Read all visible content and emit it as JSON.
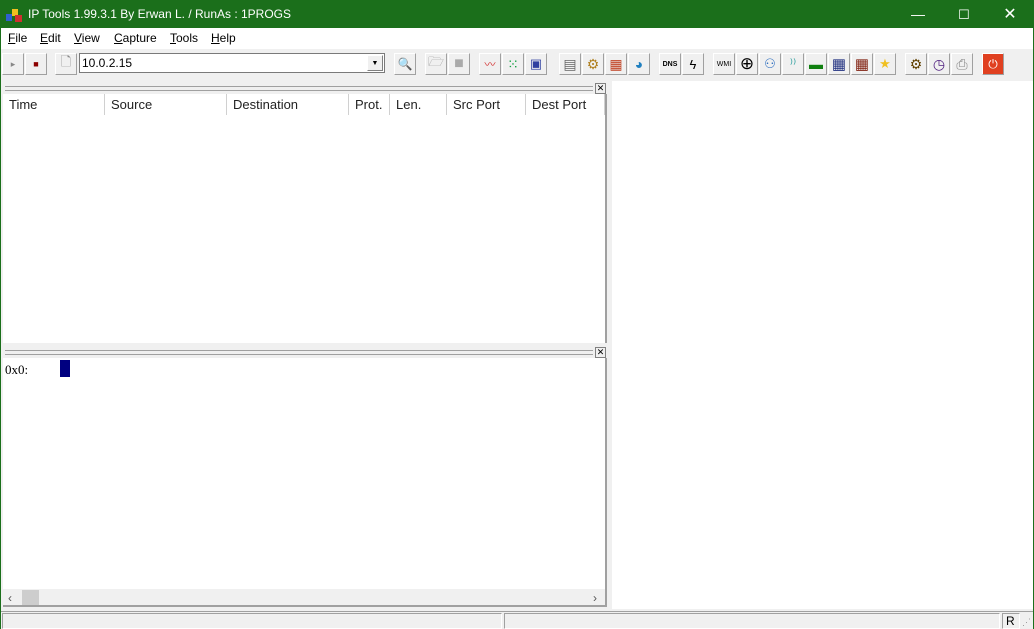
{
  "window": {
    "title": "IP Tools 1.99.3.1 By Erwan L. / RunAs : 1PROGS",
    "controls": {
      "minimize": "—",
      "maximize": "☐",
      "close": "✕"
    },
    "accent_color": "#1b6f1b"
  },
  "menubar": {
    "items": [
      {
        "label": "File",
        "accel": "F",
        "rest": "ile"
      },
      {
        "label": "Edit",
        "accel": "E",
        "rest": "dit"
      },
      {
        "label": "View",
        "accel": "V",
        "rest": "iew"
      },
      {
        "label": "Capture",
        "accel": "C",
        "rest": "apture"
      },
      {
        "label": "Tools",
        "accel": "T",
        "rest": "ools"
      },
      {
        "label": "Help",
        "accel": "H",
        "rest": "elp"
      }
    ]
  },
  "toolbar": {
    "ip_value": "10.0.2.15",
    "buttons": [
      {
        "name": "start-capture",
        "icon": "play-icon",
        "glyph": "▸"
      },
      {
        "name": "stop-capture",
        "icon": "stop-icon",
        "glyph": "■"
      },
      {
        "name": "new",
        "icon": "document-icon",
        "glyph": "🗋"
      },
      {
        "name": "search",
        "icon": "magnifier-icon",
        "glyph": "🔍"
      },
      {
        "name": "open",
        "icon": "folder-icon",
        "glyph": "🗁"
      },
      {
        "name": "blank",
        "icon": "gray-square-icon",
        "glyph": "■"
      },
      {
        "name": "graph",
        "icon": "line-graph-icon",
        "glyph": "〰"
      },
      {
        "name": "network-map",
        "icon": "network-nodes-icon",
        "glyph": "⁙"
      },
      {
        "name": "remote",
        "icon": "computers-icon",
        "glyph": "▣"
      },
      {
        "name": "servers",
        "icon": "servers-icon",
        "glyph": "▤"
      },
      {
        "name": "services",
        "icon": "gears-icon",
        "glyph": "⚙"
      },
      {
        "name": "firewall",
        "icon": "firewall-icon",
        "glyph": "▦"
      },
      {
        "name": "internet",
        "icon": "globe-icon",
        "glyph": "◕"
      },
      {
        "name": "dns",
        "icon": "dns-icon",
        "glyph": "DNS"
      },
      {
        "name": "trace",
        "icon": "trace-icon",
        "glyph": "ϟ"
      },
      {
        "name": "wmi",
        "icon": "wmi-icon",
        "glyph": "WMI"
      },
      {
        "name": "scanner",
        "icon": "crosshair-icon",
        "glyph": "⊕"
      },
      {
        "name": "users",
        "icon": "user-network-icon",
        "glyph": "⚇"
      },
      {
        "name": "ping",
        "icon": "signal-icon",
        "glyph": "⁾⁾"
      },
      {
        "name": "nic",
        "icon": "network-card-icon",
        "glyph": "▬"
      },
      {
        "name": "table-blue",
        "icon": "table-blue-icon",
        "glyph": "▦"
      },
      {
        "name": "table-red",
        "icon": "table-red-icon",
        "glyph": "▦"
      },
      {
        "name": "favorites",
        "icon": "star-icon",
        "glyph": "★"
      },
      {
        "name": "process",
        "icon": "process-icon",
        "glyph": "⚙"
      },
      {
        "name": "scheduler",
        "icon": "clock-icon",
        "glyph": "◷"
      },
      {
        "name": "print",
        "icon": "printer-icon",
        "glyph": "⎙"
      },
      {
        "name": "power",
        "icon": "power-icon",
        "glyph": "⏻"
      }
    ]
  },
  "packet_list": {
    "columns": [
      "Time",
      "Source",
      "Destination",
      "Prot.",
      "Len.",
      "Src Port",
      "Dest Port"
    ],
    "rows": []
  },
  "hex_view": {
    "address": "0x0:"
  },
  "scrollbar": {
    "left": "‹",
    "right": "›"
  },
  "statusbar": {
    "panel1": "",
    "panel2": "",
    "panel3": "R"
  }
}
